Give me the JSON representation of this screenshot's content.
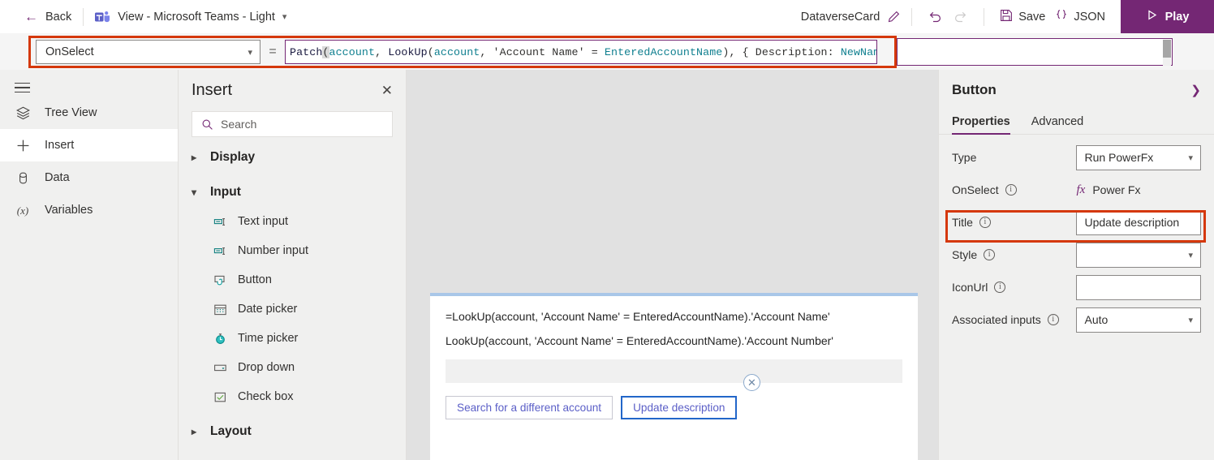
{
  "topbar": {
    "back_label": "Back",
    "view_title": "View - Microsoft Teams - Light",
    "doc_name": "DataverseCard",
    "undo_label": "undo",
    "redo_label": "redo",
    "save_label": "Save",
    "json_label": "JSON",
    "play_label": "Play"
  },
  "formula": {
    "property_selected": "OnSelect",
    "equals": "=",
    "tokens": [
      {
        "t": "Patch",
        "k": "fn"
      },
      {
        "t": "(",
        "k": "paren-hl"
      },
      {
        "t": "account",
        "k": "id"
      },
      {
        "t": ", ",
        "k": "pl"
      },
      {
        "t": "LookUp",
        "k": "fn"
      },
      {
        "t": "(",
        "k": "pl"
      },
      {
        "t": "account",
        "k": "id"
      },
      {
        "t": ", ",
        "k": "pl"
      },
      {
        "t": "'Account Name'",
        "k": "str"
      },
      {
        "t": " = ",
        "k": "pl"
      },
      {
        "t": "EnteredAccountName",
        "k": "id"
      },
      {
        "t": "), { ",
        "k": "pl"
      },
      {
        "t": "Description",
        "k": "str"
      },
      {
        "t": ": ",
        "k": "pl"
      },
      {
        "t": "NewName",
        "k": "id"
      },
      {
        "t": " }",
        "k": "pl"
      },
      {
        "t": ")",
        "k": "paren-hl"
      }
    ],
    "full_text": "Patch(account, LookUp(account, 'Account Name' = EnteredAccountName), { Description: NewName })"
  },
  "rail": {
    "items": [
      {
        "label": "Tree View",
        "icon": "layers-icon",
        "active": false
      },
      {
        "label": "Insert",
        "icon": "plus-icon",
        "active": true
      },
      {
        "label": "Data",
        "icon": "database-icon",
        "active": false
      },
      {
        "label": "Variables",
        "icon": "variables-icon",
        "active": false
      }
    ]
  },
  "insert_panel": {
    "title": "Insert",
    "search_placeholder": "Search",
    "search_value": "",
    "groups": [
      {
        "label": "Display",
        "expanded": false,
        "items": []
      },
      {
        "label": "Input",
        "expanded": true,
        "items": [
          {
            "label": "Text input",
            "icon": "text-input-icon"
          },
          {
            "label": "Number input",
            "icon": "number-input-icon"
          },
          {
            "label": "Button",
            "icon": "button-icon"
          },
          {
            "label": "Date picker",
            "icon": "calendar-icon"
          },
          {
            "label": "Time picker",
            "icon": "clock-icon"
          },
          {
            "label": "Drop down",
            "icon": "dropdown-icon"
          },
          {
            "label": "Check box",
            "icon": "checkbox-icon"
          }
        ]
      },
      {
        "label": "Layout",
        "expanded": false,
        "items": []
      }
    ]
  },
  "canvas": {
    "card": {
      "line1": "=LookUp(account, 'Account Name' = EnteredAccountName).'Account Name'",
      "line2": "LookUp(account, 'Account Name' = EnteredAccountName).'Account Number'",
      "text_input_value": "",
      "buttons": [
        {
          "label": "Search for a different account",
          "selected": false
        },
        {
          "label": "Update description",
          "selected": true
        }
      ]
    }
  },
  "properties": {
    "title": "Button",
    "tabs": [
      {
        "label": "Properties",
        "active": true
      },
      {
        "label": "Advanced",
        "active": false
      }
    ],
    "rows": [
      {
        "label": "Type",
        "info": false,
        "control": "select",
        "value": "Run PowerFx"
      },
      {
        "label": "OnSelect",
        "info": true,
        "control": "fx",
        "value": "Power Fx"
      },
      {
        "label": "Title",
        "info": true,
        "control": "text",
        "value": "Update description",
        "highlighted": true
      },
      {
        "label": "Style",
        "info": true,
        "control": "select",
        "value": ""
      },
      {
        "label": "IconUrl",
        "info": true,
        "control": "text",
        "value": ""
      },
      {
        "label": "Associated inputs",
        "info": true,
        "control": "select",
        "value": "Auto"
      }
    ]
  },
  "colors": {
    "accent_purple": "#742774",
    "highlight_orange": "#d5380c",
    "card_top_border": "#a9c7e8",
    "selected_button_border": "#2266c9",
    "canvas_bg": "#e1e1e1",
    "panel_bg": "#f0f0ef"
  }
}
